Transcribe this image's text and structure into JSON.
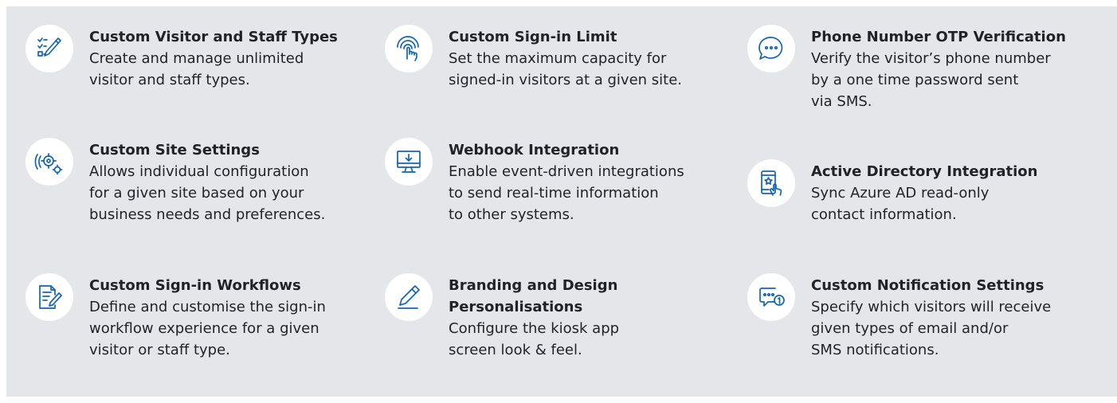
{
  "features": [
    {
      "title": [
        "Custom Visitor and Staff Types"
      ],
      "desc": [
        "Create and manage unlimited",
        "visitor and staff types."
      ],
      "icon": "checklist-pencil-icon"
    },
    {
      "title": [
        "Custom Site Settings"
      ],
      "desc": [
        "Allows individual configuration",
        "for a given site based on your",
        "business needs and preferences."
      ],
      "icon": "gear-settings-icon"
    },
    {
      "title": [
        "Custom Sign-in Workflows"
      ],
      "desc": [
        "Define and customise the sign-in",
        "workflow experience for a given",
        "visitor or staff type."
      ],
      "icon": "document-pen-icon"
    },
    {
      "title": [
        "Custom Sign-in Limit"
      ],
      "desc": [
        "Set the maximum capacity for",
        "signed-in visitors at a given site."
      ],
      "icon": "touch-hand-icon"
    },
    {
      "title": [
        "Webhook Integration"
      ],
      "desc": [
        "Enable event-driven integrations",
        "to send real-time information",
        "to other systems."
      ],
      "icon": "monitor-download-icon"
    },
    {
      "title": [
        "Branding and Design",
        "Personalisations"
      ],
      "desc": [
        "Configure the kiosk app",
        "screen look & feel."
      ],
      "icon": "pencil-icon"
    },
    {
      "title": [
        "Phone Number OTP Verification"
      ],
      "desc": [
        "Verify the visitor’s phone number",
        "by a one time password sent",
        "via SMS."
      ],
      "icon": "chat-bubble-dots-icon"
    },
    {
      "title": [
        "Active Directory Integration"
      ],
      "desc": [
        "Sync Azure AD read-only",
        "contact information."
      ],
      "icon": "phone-star-hand-icon"
    },
    {
      "title": [
        "Custom Notification Settings"
      ],
      "desc": [
        "Specify which visitors will receive",
        "given types of email and/or",
        "SMS notifications."
      ],
      "icon": "message-notification-icon"
    }
  ]
}
